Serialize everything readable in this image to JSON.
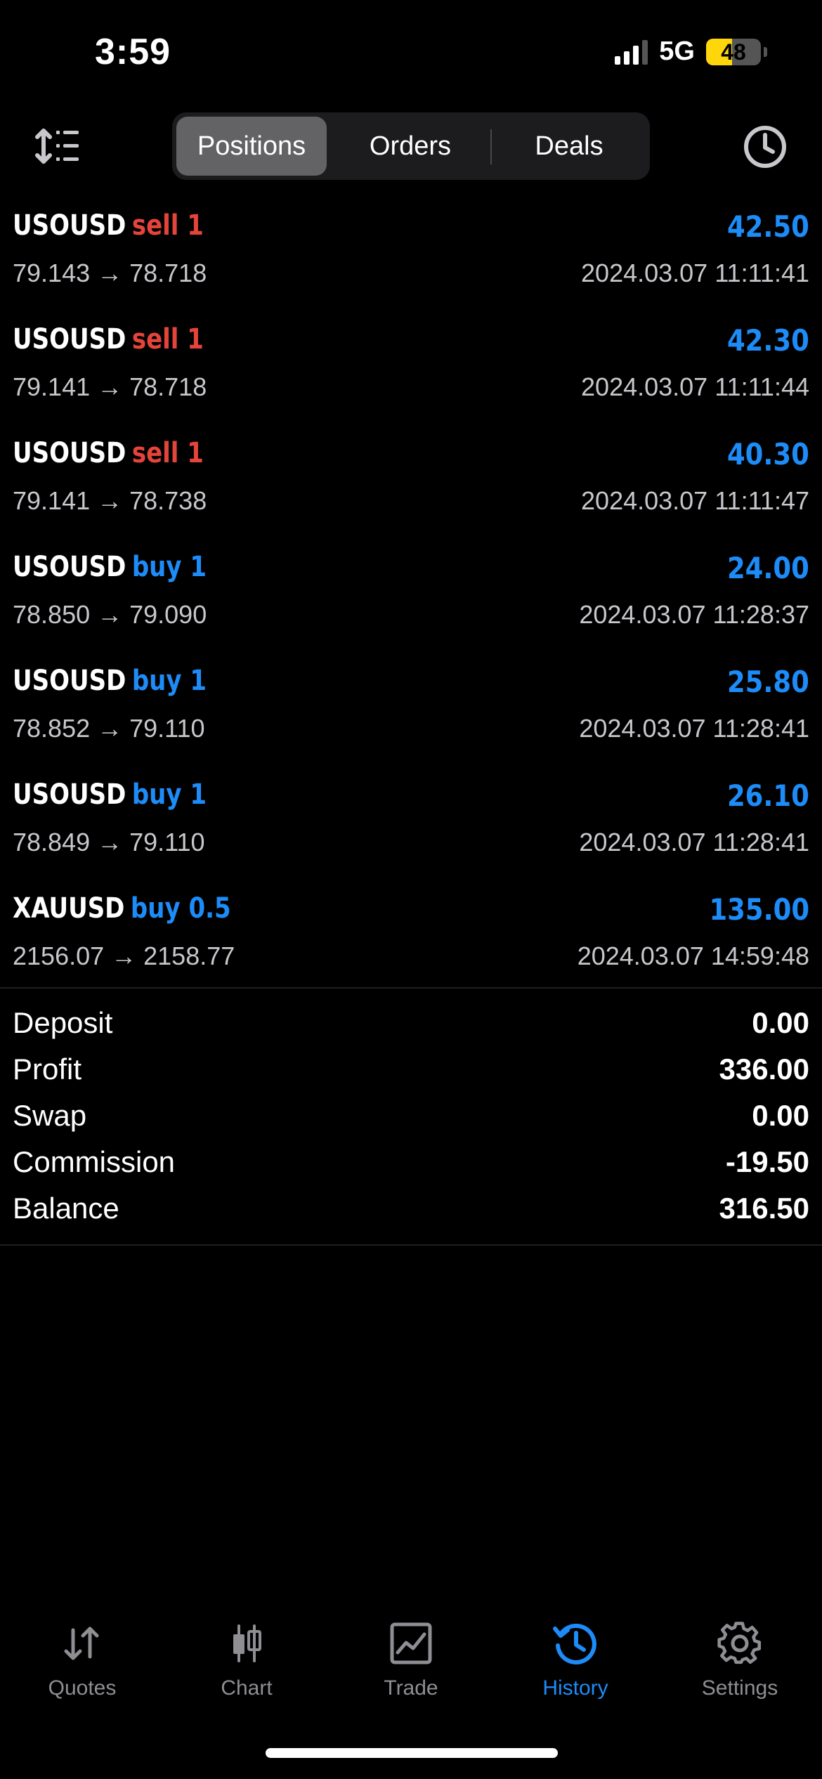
{
  "status_bar": {
    "time": "3:59",
    "network": "5G",
    "battery_percent": "48",
    "battery_level": 0.48,
    "signal_bars_active": 3
  },
  "segmented_control": {
    "tabs": [
      {
        "label": "Positions",
        "active": true
      },
      {
        "label": "Orders",
        "active": false
      },
      {
        "label": "Deals",
        "active": false
      }
    ]
  },
  "icons": {
    "sort": "sort-list-icon",
    "period": "clock-icon"
  },
  "colors": {
    "sell": "#e5443a",
    "buy": "#1d8cf8",
    "profit": "#1d8cf8",
    "active_tab": "#1d8cf8",
    "inactive_tab": "#8e8e93"
  },
  "deals": [
    {
      "symbol": "USOUSD",
      "side": "sell",
      "volume": "sell 1",
      "profit": "42.50",
      "prices": "79.143 → 78.718",
      "time": "2024.03.07 11:11:41"
    },
    {
      "symbol": "USOUSD",
      "side": "sell",
      "volume": "sell 1",
      "profit": "42.30",
      "prices": "79.141 → 78.718",
      "time": "2024.03.07 11:11:44"
    },
    {
      "symbol": "USOUSD",
      "side": "sell",
      "volume": "sell 1",
      "profit": "40.30",
      "prices": "79.141 → 78.738",
      "time": "2024.03.07 11:11:47"
    },
    {
      "symbol": "USOUSD",
      "side": "buy",
      "volume": "buy 1",
      "profit": "24.00",
      "prices": "78.850 → 79.090",
      "time": "2024.03.07 11:28:37"
    },
    {
      "symbol": "USOUSD",
      "side": "buy",
      "volume": "buy 1",
      "profit": "25.80",
      "prices": "78.852 → 79.110",
      "time": "2024.03.07 11:28:41"
    },
    {
      "symbol": "USOUSD",
      "side": "buy",
      "volume": "buy 1",
      "profit": "26.10",
      "prices": "78.849 → 79.110",
      "time": "2024.03.07 11:28:41"
    },
    {
      "symbol": "XAUUSD",
      "side": "buy",
      "volume": "buy 0.5",
      "profit": "135.00",
      "prices": "2156.07 → 2158.77",
      "time": "2024.03.07 14:59:48"
    }
  ],
  "summary": [
    {
      "label": "Deposit",
      "value": "0.00"
    },
    {
      "label": "Profit",
      "value": "336.00"
    },
    {
      "label": "Swap",
      "value": "0.00"
    },
    {
      "label": "Commission",
      "value": "-19.50"
    },
    {
      "label": "Balance",
      "value": "316.50"
    }
  ],
  "tab_bar": {
    "tabs": [
      {
        "label": "Quotes",
        "icon": "quotes-arrows-icon",
        "active": false
      },
      {
        "label": "Chart",
        "icon": "candlestick-chart-icon",
        "active": false
      },
      {
        "label": "Trade",
        "icon": "trade-chart-icon",
        "active": false
      },
      {
        "label": "History",
        "icon": "history-clock-icon",
        "active": true
      },
      {
        "label": "Settings",
        "icon": "gear-icon",
        "active": false
      }
    ]
  }
}
